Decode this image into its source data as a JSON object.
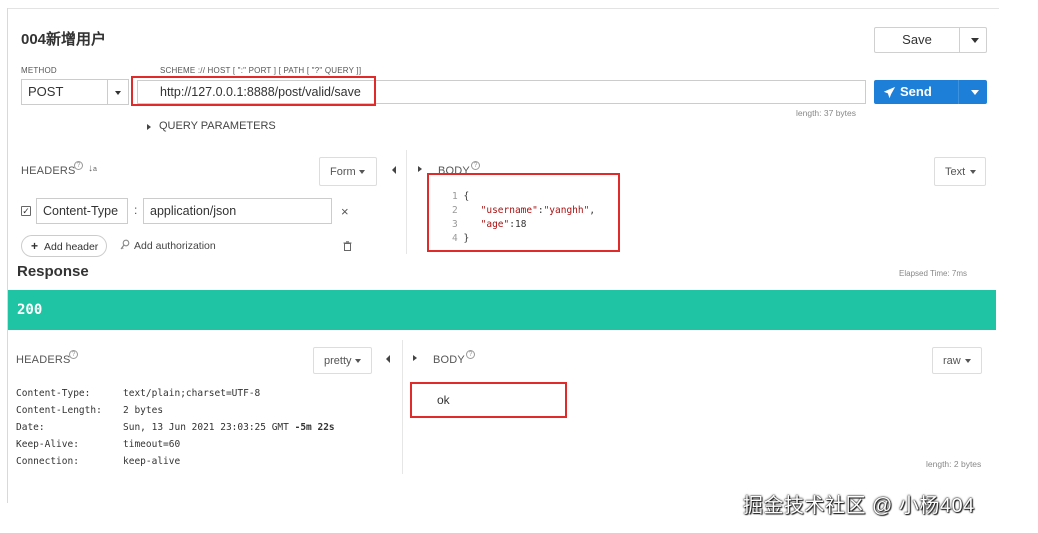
{
  "request": {
    "title": "004新增用户",
    "save_label": "Save",
    "method_label": "METHOD",
    "method_value": "POST",
    "url_label": "SCHEME :// HOST [ \":\" PORT ] [ PATH [ \"?\" QUERY ]]",
    "url_value": "http://127.0.0.1:8888/post/valid/save",
    "send_label": "Send",
    "length_text": "length: 37 bytes",
    "query_params_label": "QUERY PARAMETERS"
  },
  "headers_panel": {
    "title": "HEADERS",
    "sort_icon": "↓a z",
    "mode_label": "Form",
    "rows": [
      {
        "name": "Content-Type",
        "value": "application/json",
        "enabled": true
      }
    ],
    "add_header_label": "Add header",
    "add_authorization_label": "Add authorization"
  },
  "body_panel": {
    "title": "BODY",
    "mode_label": "Text",
    "lines": [
      {
        "num": "1",
        "text": "{"
      },
      {
        "num": "2",
        "key": "\"username\"",
        "sep": ":",
        "val": "\"yanghh\"",
        "tail": ","
      },
      {
        "num": "3",
        "key": "\"age\"",
        "sep": ":",
        "val": "18",
        "tail": ""
      },
      {
        "num": "4",
        "text": "}"
      }
    ]
  },
  "response": {
    "title": "Response",
    "elapsed": "Elapsed Time: 7ms",
    "status_code": "200",
    "headers_title": "HEADERS",
    "headers_mode": "pretty",
    "headers": [
      {
        "name": "Content-Type:",
        "value": "text/plain;charset=UTF-8",
        "extra": ""
      },
      {
        "name": "Content-Length:",
        "value": "2 bytes",
        "extra": ""
      },
      {
        "name": "Date:",
        "value": "Sun, 13 Jun 2021 23:03:25 GMT ",
        "extra": "-5m 22s"
      },
      {
        "name": "Keep-Alive:",
        "value": "timeout=60",
        "extra": ""
      },
      {
        "name": "Connection:",
        "value": "keep-alive",
        "extra": ""
      }
    ],
    "body_title": "BODY",
    "body_mode": "raw",
    "body_text": "ok",
    "length_text": "length: 2 bytes"
  },
  "watermark": "掘金技术社区 @ 小杨404",
  "colors": {
    "status_bar": "#1ec4a3",
    "send_button": "#1e7fd8",
    "annotation_box": "#e12b2b"
  },
  "icons": {
    "send": "paper-plane-icon",
    "info": "question-circle-icon",
    "trash": "trash-icon",
    "key": "key-icon",
    "plus": "plus-icon",
    "remove": "close-icon"
  }
}
